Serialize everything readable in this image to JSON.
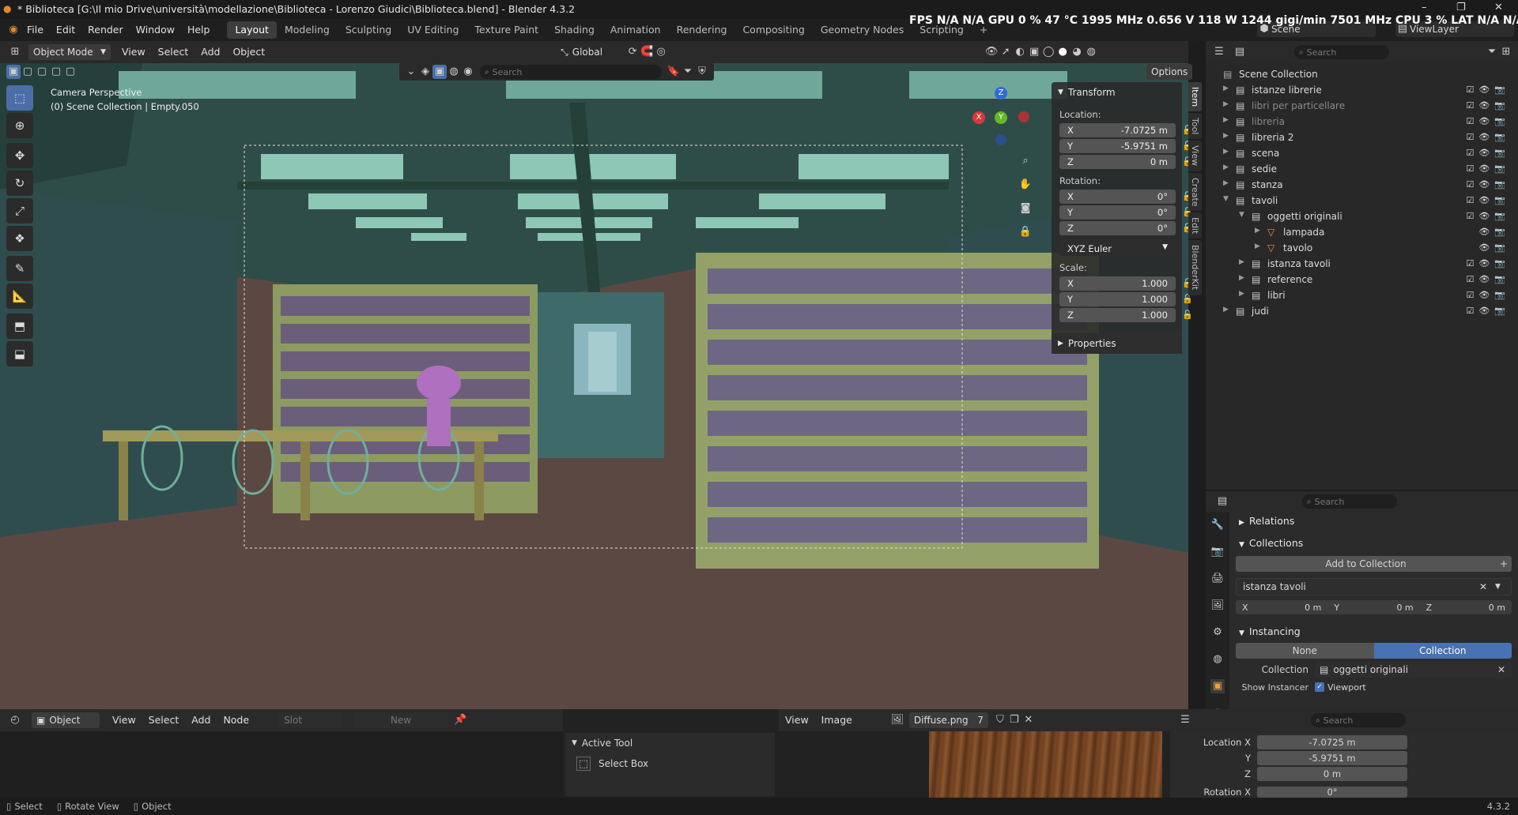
{
  "window": {
    "title": "* Biblioteca [G:\\Il mio Drive\\università\\modellazione\\Biblioteca - Lorenzo Giudici\\Biblioteca.blend] - Blender 4.3.2",
    "stats": "FPS N/A N/A   GPU 0 %  47 °C  1995 MHz  0.656 V  118 W  1244 gigi/min  7501 MHz    CPU  3 %        LAT  N/A  N/A",
    "minimize": "–",
    "maximize": "❐",
    "close": "✕"
  },
  "menu": {
    "items": [
      "File",
      "Edit",
      "Render",
      "Window",
      "Help"
    ],
    "workspaces": [
      "Layout",
      "Modeling",
      "Sculpting",
      "UV Editing",
      "Texture Paint",
      "Shading",
      "Animation",
      "Rendering",
      "Compositing",
      "Geometry Nodes",
      "Scripting"
    ],
    "active_workspace": "Layout",
    "add_workspace": "+",
    "scene_label": "Scene",
    "viewlayer_label": "ViewLayer"
  },
  "viewport_header": {
    "mode": "Object Mode",
    "menus": [
      "View",
      "Select",
      "Add",
      "Object"
    ],
    "orientation": "Global",
    "options": "Options",
    "search_placeholder": "Search"
  },
  "viewport": {
    "camera_line1": "Camera Perspective",
    "camera_line2": "(0) Scene Collection | Empty.050",
    "gizmo": {
      "x": "X",
      "y": "Y",
      "z": "Z"
    }
  },
  "npanel": {
    "transform_title": "Transform",
    "location_label": "Location:",
    "location": [
      {
        "axis": "X",
        "value": "-7.0725 m"
      },
      {
        "axis": "Y",
        "value": "-5.9751 m"
      },
      {
        "axis": "Z",
        "value": "0 m"
      }
    ],
    "rotation_label": "Rotation:",
    "rotation": [
      {
        "axis": "X",
        "value": "0°"
      },
      {
        "axis": "Y",
        "value": "0°"
      },
      {
        "axis": "Z",
        "value": "0°"
      }
    ],
    "rotation_mode": "XYZ Euler",
    "scale_label": "Scale:",
    "scale": [
      {
        "axis": "X",
        "value": "1.000"
      },
      {
        "axis": "Y",
        "value": "1.000"
      },
      {
        "axis": "Z",
        "value": "1.000"
      }
    ],
    "properties_title": "Properties",
    "tabs": [
      "Item",
      "Tool",
      "View",
      "Create",
      "Edit",
      "BlenderKit"
    ]
  },
  "outliner": {
    "search_placeholder": "Search",
    "root": "Scene Collection",
    "rows": [
      {
        "name": "istanze librerie",
        "indent": 0,
        "type": "coll",
        "dim": false
      },
      {
        "name": "libri per particellare",
        "indent": 0,
        "type": "coll",
        "dim": true
      },
      {
        "name": "libreria",
        "indent": 0,
        "type": "coll",
        "dim": true
      },
      {
        "name": "libreria 2",
        "indent": 0,
        "type": "coll",
        "dim": false
      },
      {
        "name": "scena",
        "indent": 0,
        "type": "coll",
        "dim": false
      },
      {
        "name": "sedie",
        "indent": 0,
        "type": "coll",
        "dim": false
      },
      {
        "name": "stanza",
        "indent": 0,
        "type": "coll",
        "dim": false
      },
      {
        "name": "tavoli",
        "indent": 0,
        "type": "coll",
        "dim": false
      },
      {
        "name": "oggetti originali",
        "indent": 1,
        "type": "coll",
        "dim": false
      },
      {
        "name": "lampada",
        "indent": 2,
        "type": "mesh",
        "dim": false
      },
      {
        "name": "tavolo",
        "indent": 2,
        "type": "mesh",
        "dim": false
      },
      {
        "name": "istanza tavoli",
        "indent": 1,
        "type": "coll",
        "dim": false
      },
      {
        "name": "reference",
        "indent": 1,
        "type": "coll",
        "dim": false
      },
      {
        "name": "libri",
        "indent": 1,
        "type": "coll",
        "dim": false
      },
      {
        "name": "judi",
        "indent": 0,
        "type": "coll",
        "dim": false
      }
    ]
  },
  "properties": {
    "search_placeholder": "Search",
    "relations": "Relations",
    "collections": "Collections",
    "add_to_collection": "Add to Collection",
    "collection_name": "istanza tavoli",
    "offset": [
      {
        "axis": "X",
        "value": "0 m"
      },
      {
        "axis": "Y",
        "value": "0 m"
      },
      {
        "axis": "Z",
        "value": "0 m"
      }
    ],
    "instancing": "Instancing",
    "inst_none": "None",
    "inst_collection": "Collection",
    "collection_label": "Collection",
    "collection_value": "oggetti originali",
    "show_instancer": "Show Instancer",
    "viewport_label": "Viewport"
  },
  "bottom": {
    "node_mode": "Object",
    "node_menus": [
      "View",
      "Select",
      "Add",
      "Node"
    ],
    "slot": "Slot",
    "new_label": "New",
    "active_tool": "Active Tool",
    "select_box": "Select Box",
    "image_menus": [
      "View",
      "Image"
    ],
    "image_name": "Diffuse.png",
    "image_users": "7",
    "search_placeholder": "Search",
    "location_x_label": "Location X",
    "location_x": "-7.0725 m",
    "y_label": "Y",
    "location_y": "-5.9751 m",
    "z_label": "Z",
    "location_z": "0 m",
    "rotation_x_label": "Rotation X",
    "rotation_x": "0°"
  },
  "status": {
    "select": "Select",
    "rotate": "Rotate View",
    "object": "Object",
    "version": "4.3.2"
  },
  "colors": {
    "accent": "#4772b3",
    "floor": "#5c4843",
    "ceiling": "#35544f",
    "skylight": "#8dc7b5",
    "shelf": "#93a168"
  }
}
